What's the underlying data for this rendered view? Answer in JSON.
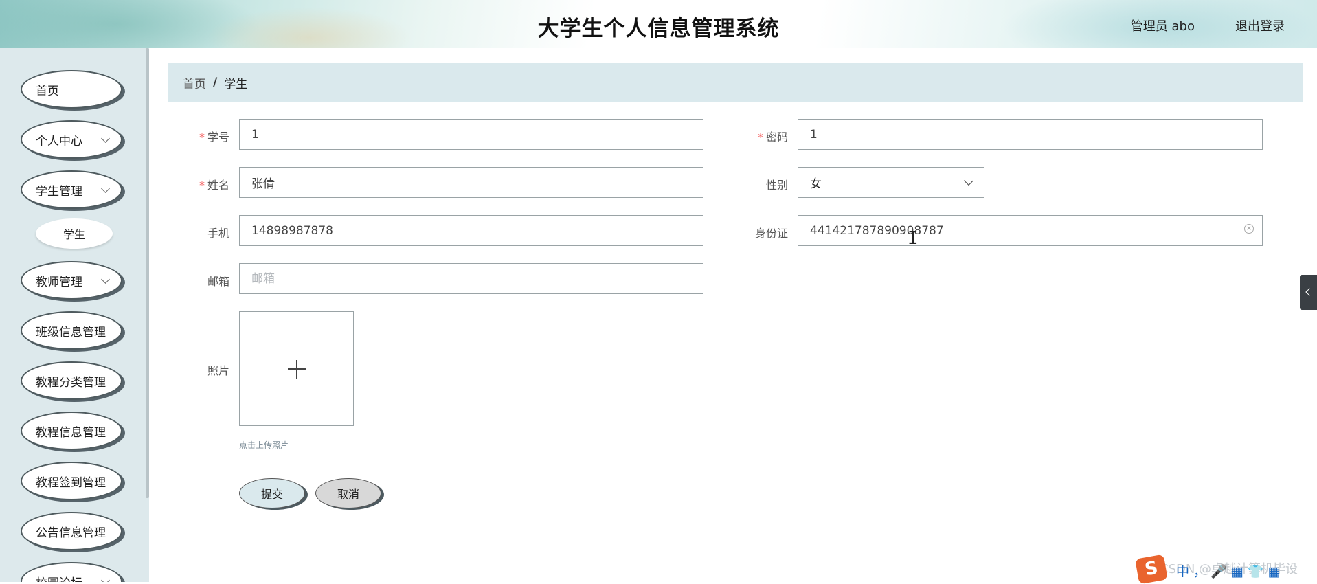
{
  "header": {
    "title": "大学生个人信息管理系统",
    "user": "管理员 abo",
    "logout": "退出登录"
  },
  "sidebar": {
    "items": [
      {
        "label": "首页",
        "expandable": false
      },
      {
        "label": "个人中心",
        "expandable": true
      },
      {
        "label": "学生管理",
        "expandable": true
      },
      {
        "label": "学生",
        "sub": true
      },
      {
        "label": "教师管理",
        "expandable": true
      },
      {
        "label": "班级信息管理",
        "expandable": false
      },
      {
        "label": "教程分类管理",
        "expandable": false
      },
      {
        "label": "教程信息管理",
        "expandable": false
      },
      {
        "label": "教程签到管理",
        "expandable": false
      },
      {
        "label": "公告信息管理",
        "expandable": false
      },
      {
        "label": "校园论坛",
        "expandable": true
      }
    ]
  },
  "breadcrumb": {
    "home": "首页",
    "separator": "/",
    "current": "学生"
  },
  "form": {
    "student_id": {
      "label": "学号",
      "value": "1",
      "required": true
    },
    "password": {
      "label": "密码",
      "value": "1",
      "required": true
    },
    "name": {
      "label": "姓名",
      "value": "张倩",
      "required": true
    },
    "gender": {
      "label": "性别",
      "value": "女"
    },
    "phone": {
      "label": "手机",
      "value": "14898987878"
    },
    "id_card": {
      "label": "身份证",
      "value": "441421787890908787"
    },
    "email": {
      "label": "邮箱",
      "value": "",
      "placeholder": "邮箱"
    },
    "photo": {
      "label": "照片",
      "hint": "点击上传照片"
    },
    "submit": "提交",
    "cancel": "取消"
  },
  "required_mark": "*",
  "overlay": {
    "watermark": "CSDN @卓越计算机毕设",
    "ime_logo": "S",
    "ime_icons": "中 ， 🎤 ▦ 👕 ▦"
  },
  "colors": {
    "accent": "#dae9ed",
    "required": "#f56c6c",
    "sidebar_bg": "#dde9ec"
  }
}
